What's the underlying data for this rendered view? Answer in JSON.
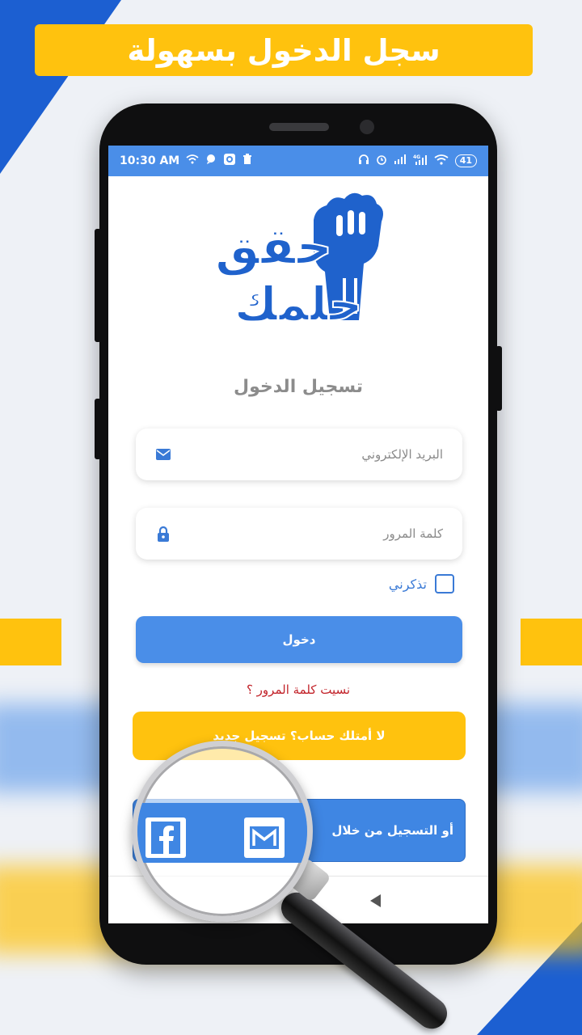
{
  "banner": {
    "text": "سجل الدخول بسهولة"
  },
  "status_bar": {
    "time": "10:30 AM",
    "battery": "41"
  },
  "logo": {
    "line1": "حقق",
    "line2": "حلمك"
  },
  "login": {
    "title": "تسجيل الدخول",
    "email_placeholder": "البريد الإلكتروني",
    "password_placeholder": "كلمة المرور",
    "remember_label": "تذكرني",
    "remember_checked": false,
    "login_button": "دخول",
    "forgot_link": "نسيت كلمة المرور ؟",
    "register_button": "لا أمتلك حساب؟ تسجيل جديد",
    "social_label": "أو التسجيل من خلال"
  },
  "icons": {
    "email": "envelope-icon",
    "password": "lock-icon",
    "facebook": "facebook-icon",
    "gmail": "gmail-icon"
  },
  "colors": {
    "primary_blue": "#4a8ee8",
    "accent_yellow": "#ffc20e",
    "error_red": "#c2232a"
  }
}
